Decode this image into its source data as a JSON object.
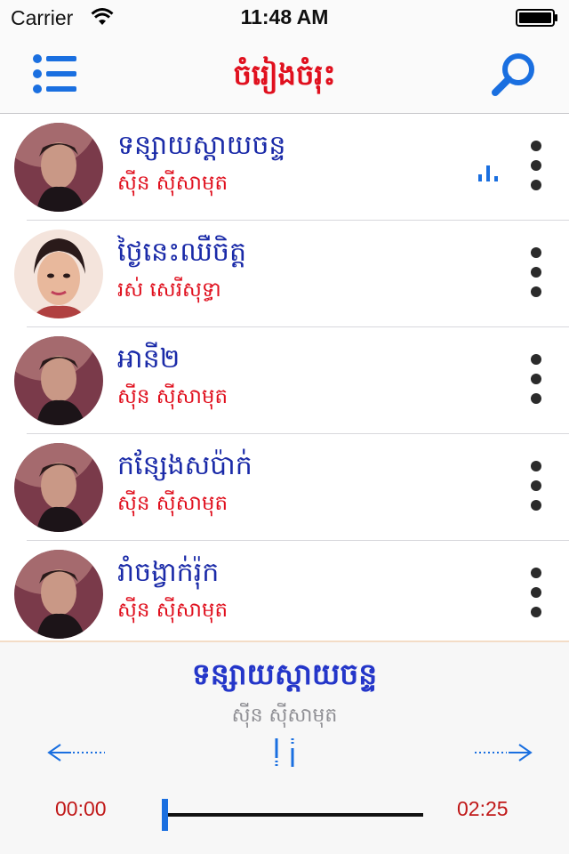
{
  "status_bar": {
    "carrier": "Carrier",
    "time": "11:48 AM"
  },
  "nav": {
    "title": "ចំរៀងចំរុះ",
    "menu_icon": "list-icon",
    "search_icon": "search-icon"
  },
  "songs": [
    {
      "title": "ទន្សាយស្តាយចន្ទ",
      "artist": "ស៊ីន ស៊ីសាមុត",
      "playing": true
    },
    {
      "title": "ថ្ងៃនេះឈឺចិត្ត",
      "artist": "រស់ សេរីសុទ្ធា",
      "playing": false
    },
    {
      "title": "អានី២",
      "artist": "ស៊ីន ស៊ីសាមុត",
      "playing": false
    },
    {
      "title": "កន្សែងសប៉ាក់",
      "artist": "ស៊ីន ស៊ីសាមុត",
      "playing": false
    },
    {
      "title": "រាំចង្វាក់រ៉ុក",
      "artist": "ស៊ីន ស៊ីសាមុត",
      "playing": false
    }
  ],
  "player": {
    "title": "ទន្សាយស្តាយចន្ទ",
    "artist": "ស៊ីន ស៊ីសាមុត",
    "current_time": "00:00",
    "total_time": "02:25",
    "progress": 0.0
  },
  "colors": {
    "accent_blue": "#1a6fe0",
    "title_red": "#e0101e",
    "song_title_blue": "#1a2aa8"
  }
}
